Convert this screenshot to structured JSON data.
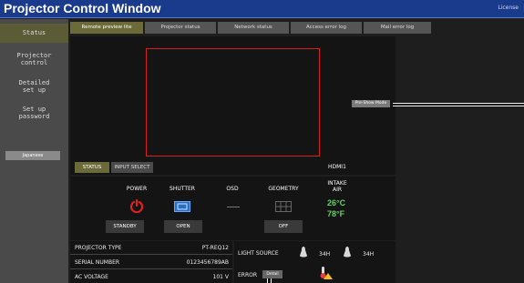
{
  "window": {
    "title": "Projector Control Window",
    "license_label": "License"
  },
  "sidebar": {
    "status_label": "Status",
    "items": [
      {
        "line1": "Projector",
        "line2": "control"
      },
      {
        "line1": "Detailed",
        "line2": "set up"
      },
      {
        "line1": "Set up",
        "line2": "password"
      }
    ],
    "language_label": "Japanese"
  },
  "tabs": [
    {
      "label": "Remote preview lite"
    },
    {
      "label": "Projector status"
    },
    {
      "label": "Network status"
    },
    {
      "label": "Access error log"
    },
    {
      "label": "Mail error log"
    }
  ],
  "preview": {
    "preshow_label": "Pre-Show Mode",
    "status_button": "STATUS",
    "input_select_button": "INPUT SELECT",
    "input_value": "HDMI1"
  },
  "controls": {
    "power_label": "POWER",
    "power_state": "STANDBY",
    "shutter_label": "SHUTTER",
    "shutter_state": "OPEN",
    "osd_label": "OSD",
    "geometry_label": "GEOMETRY",
    "geometry_state": "OFF",
    "intake_label_1": "INTAKE",
    "intake_label_2": "AIR",
    "temp_c": "26°C",
    "temp_f": "78°F",
    "accent_green": "#5cd65c",
    "power_icon_color": "#e02020"
  },
  "info": {
    "rows": [
      {
        "key": "PROJECTOR TYPE",
        "value": "PT-REQ12"
      },
      {
        "key": "SERIAL NUMBER",
        "value": "0123456789AB"
      },
      {
        "key": "AC VOLTAGE",
        "value": "101 V"
      }
    ]
  },
  "light": {
    "source_label": "LIGHT SOURCE",
    "hours_1": "34H",
    "hours_2": "34H",
    "error_label": "ERROR",
    "detail_label": "Detail"
  }
}
